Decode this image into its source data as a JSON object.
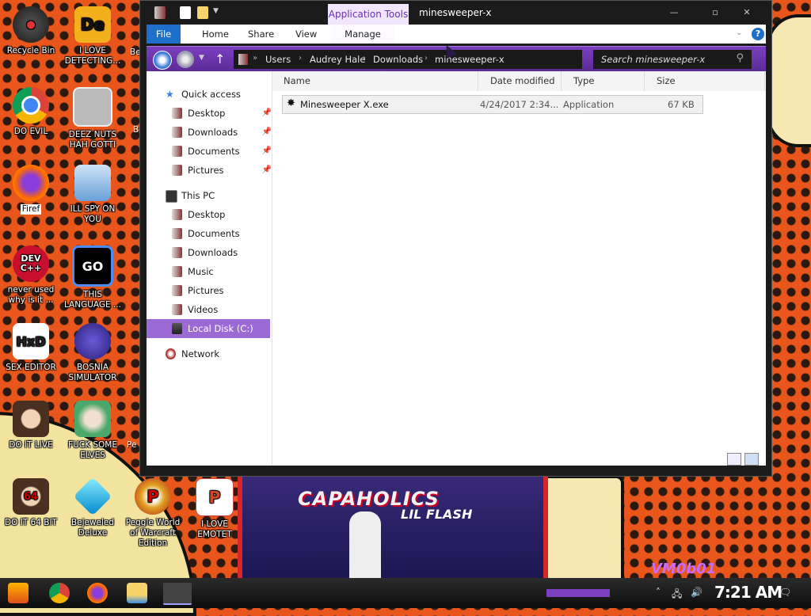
{
  "desktop": {
    "icons": [
      {
        "label": "Recycle Bin"
      },
      {
        "label": "I LOVE DETECTING..."
      },
      {
        "label": "DO EVIL"
      },
      {
        "label": "DEEZ NUTS HAH GOTTI"
      },
      {
        "label": "Firef"
      },
      {
        "label": "ILL SPY ON YOU"
      },
      {
        "label": "never used why is it ..."
      },
      {
        "label": "THIS LANGUAGE ..."
      },
      {
        "label": "SEX EDITOR"
      },
      {
        "label": "BOSNIA SIMULATOR"
      },
      {
        "label": "DO IT LIVE"
      },
      {
        "label": "FUCK SOME ELVES"
      },
      {
        "label": "DO IT 64 BIT"
      },
      {
        "label": "Bejeweled Deluxe"
      },
      {
        "label": "Peggle World of Warcraft Edition"
      },
      {
        "label": "I LOVE EMOTET"
      }
    ],
    "partial_labels": [
      "Be",
      "Be",
      "Pe"
    ],
    "wallpaper_text": [
      "CAPAHOLICS",
      "LIL FLASH",
      "VM0b01"
    ]
  },
  "explorer": {
    "ribbon_context": "Application Tools",
    "title": "minesweeper-x",
    "tabs": [
      "File",
      "Home",
      "Share",
      "View",
      "Manage"
    ],
    "breadcrumb": [
      "Users",
      "Audrey Hale",
      "Downloads",
      "minesweeper-x"
    ],
    "search_placeholder": "Search minesweeper-x",
    "columns": [
      "Name",
      "Date modified",
      "Type",
      "Size"
    ],
    "files": [
      {
        "name": "Minesweeper X.exe",
        "date": "4/24/2017 2:34...",
        "type": "Application",
        "size": "67 KB"
      }
    ],
    "nav": {
      "quick_access": "Quick access",
      "quick_items": [
        "Desktop",
        "Downloads",
        "Documents",
        "Pictures"
      ],
      "this_pc": "This PC",
      "pc_items": [
        "Desktop",
        "Documents",
        "Downloads",
        "Music",
        "Pictures",
        "Videos",
        "Local Disk (C:)"
      ],
      "network": "Network"
    }
  },
  "taskbar": {
    "clock": "7:21 AM"
  },
  "colors": {
    "accent": "#7b3fbf",
    "file_tab": "#1e6fc9",
    "wallpaper": "#e8561c"
  }
}
